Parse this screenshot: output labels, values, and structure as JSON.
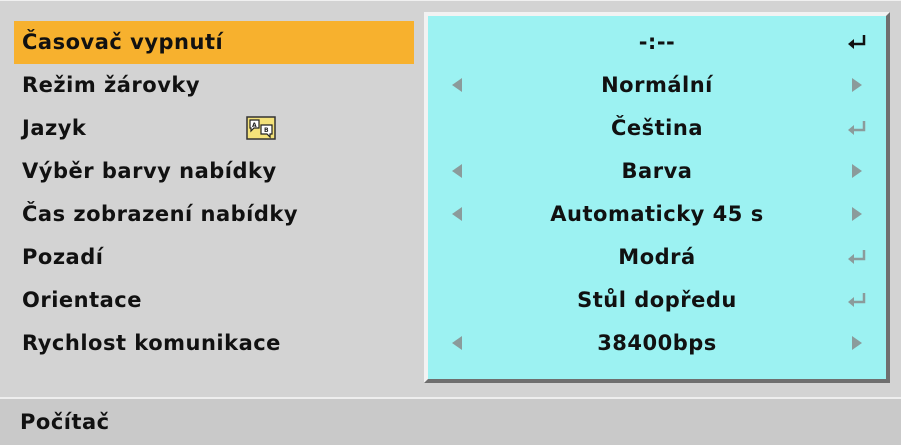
{
  "menu": {
    "items": [
      {
        "label": "Časovač vypnutí",
        "value": "-:--",
        "control": "enter",
        "selected": true
      },
      {
        "label": "Režim žárovky",
        "value": "Normální",
        "control": "arrows",
        "selected": false
      },
      {
        "label": "Jazyk",
        "value": "Čeština",
        "control": "enter",
        "selected": false,
        "icon": "language-icon"
      },
      {
        "label": "Výběr barvy nabídky",
        "value": "Barva",
        "control": "arrows",
        "selected": false
      },
      {
        "label": "Čas zobrazení nabídky",
        "value": "Automaticky 45 s",
        "control": "arrows",
        "selected": false
      },
      {
        "label": "Pozadí",
        "value": "Modrá",
        "control": "enter",
        "selected": false
      },
      {
        "label": "Orientace",
        "value": "Stůl dopředu",
        "control": "enter",
        "selected": false
      },
      {
        "label": "Rychlost komunikace",
        "value": "38400bps",
        "control": "arrows",
        "selected": false
      }
    ]
  },
  "status_bar": {
    "source": "Počítač"
  },
  "colors": {
    "selected_highlight": "#f7b12e",
    "value_panel": "#9cf2f2",
    "background": "#d3d3d3",
    "active_enter_icon": "#111111",
    "inactive_control": "#8b9b9b"
  }
}
